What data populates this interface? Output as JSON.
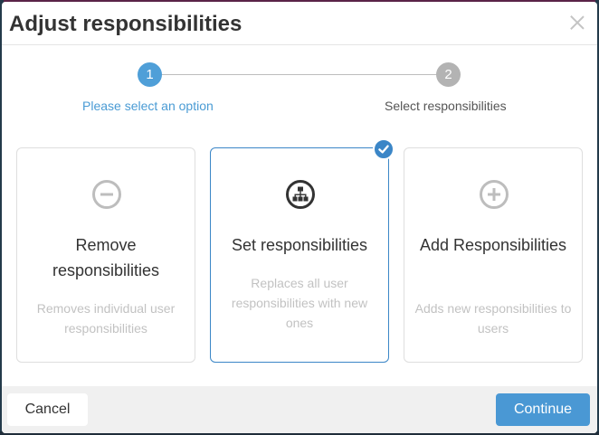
{
  "dialog": {
    "title": "Adjust responsibilities"
  },
  "wizard": {
    "steps": [
      {
        "number": "1",
        "label": "Please select an option",
        "state": "active"
      },
      {
        "number": "2",
        "label": "Select responsibilities",
        "state": "inactive"
      }
    ]
  },
  "options": [
    {
      "title": "Remove responsibilities",
      "description": "Removes individual user responsibilities",
      "icon": "minus-circle-icon",
      "selected": false
    },
    {
      "title": "Set responsibilities",
      "description": "Replaces all user responsibilities with new ones",
      "icon": "hierarchy-icon",
      "selected": true
    },
    {
      "title": "Add Responsibilities",
      "description": "Adds new responsibilities to users",
      "icon": "plus-circle-icon",
      "selected": false
    }
  ],
  "footer": {
    "cancel_label": "Cancel",
    "continue_label": "Continue"
  },
  "colors": {
    "accent": "#4a98d4",
    "selected_border": "#3b86c7",
    "inactive_step": "#b3b3b3"
  }
}
